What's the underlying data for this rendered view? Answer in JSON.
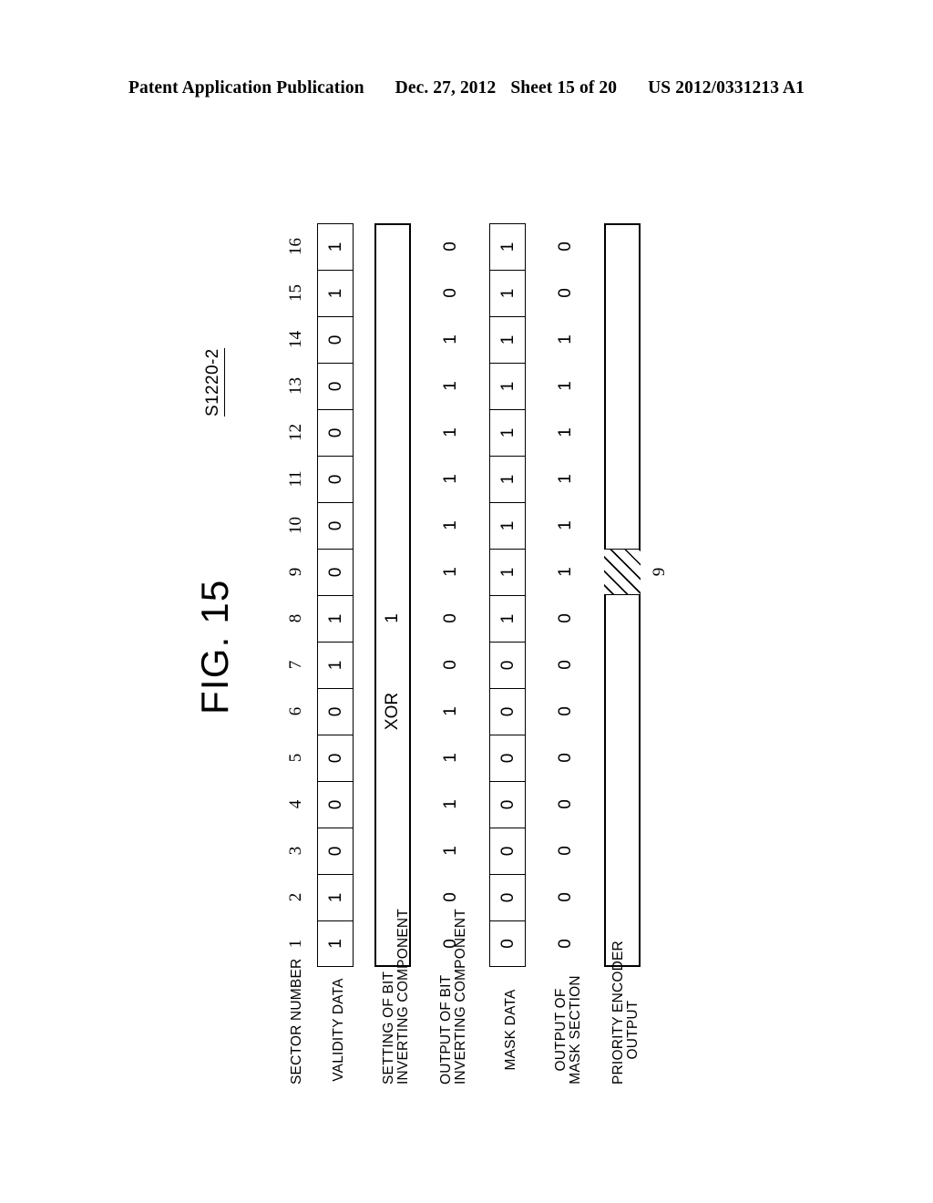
{
  "header": {
    "publication": "Patent Application Publication",
    "date": "Dec. 27, 2012",
    "sheet": "Sheet 15 of 20",
    "patent_number": "US 2012/0331213 A1"
  },
  "figure": {
    "caption": "FIG. 15",
    "step_reference": "S1220-2",
    "hatch_marker_label": "9"
  },
  "rows": {
    "sector_number": {
      "label": "SECTOR NUMBER",
      "values": [
        "1",
        "2",
        "3",
        "4",
        "5",
        "6",
        "7",
        "8",
        "9",
        "10",
        "11",
        "12",
        "13",
        "14",
        "15",
        "16"
      ]
    },
    "validity_data": {
      "label": "VALIDITY DATA",
      "values": [
        "1",
        "1",
        "0",
        "0",
        "0",
        "0",
        "1",
        "1",
        "0",
        "0",
        "0",
        "0",
        "0",
        "0",
        "1",
        "1"
      ]
    },
    "setting_of_bit_inverting_component": {
      "label_line1": "SETTING OF BIT",
      "label_line2": "INVERTING COMPONENT",
      "op_label": "XOR",
      "op_value": "1"
    },
    "output_of_bit_inverting_component": {
      "label_line1": "OUTPUT OF BIT",
      "label_line2": "INVERTING COMPONENT",
      "values": [
        "0",
        "0",
        "1",
        "1",
        "1",
        "1",
        "0",
        "0",
        "1",
        "1",
        "1",
        "1",
        "1",
        "1",
        "0",
        "0"
      ]
    },
    "mask_data": {
      "label": "MASK DATA",
      "values": [
        "0",
        "0",
        "0",
        "0",
        "0",
        "0",
        "0",
        "1",
        "1",
        "1",
        "1",
        "1",
        "1",
        "1",
        "1",
        "1"
      ]
    },
    "output_of_mask_section": {
      "label_line1": "OUTPUT OF",
      "label_line2": "MASK SECTION",
      "values": [
        "0",
        "0",
        "0",
        "0",
        "0",
        "0",
        "0",
        "0",
        "1",
        "1",
        "1",
        "1",
        "1",
        "1",
        "0",
        "0"
      ]
    },
    "priority_encoder_output": {
      "label_line1": "PRIORITY ENCODER",
      "label_line2": "OUTPUT",
      "selected_sector": "9"
    }
  },
  "colors": {
    "ink": "#000000",
    "paper": "#ffffff"
  }
}
